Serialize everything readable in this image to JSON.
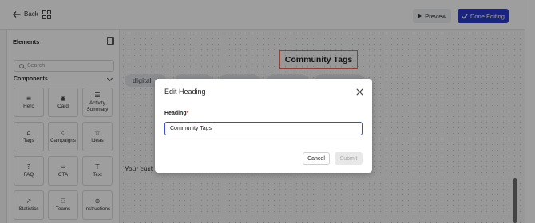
{
  "topbar": {
    "back_label": "Back",
    "preview_label": "Preview",
    "done_label": "Done Editing",
    "accent_color": "#2b3bc9"
  },
  "sidebar": {
    "title": "Elements",
    "search_placeholder": "Search",
    "section_label": "Components",
    "components": [
      {
        "label": "Hero",
        "icon": "≡"
      },
      {
        "label": "Card",
        "icon": "◉"
      },
      {
        "label": "Activity Summary",
        "icon": "☰"
      },
      {
        "label": "Tags",
        "icon": "⌂"
      },
      {
        "label": "Campaigns",
        "icon": "◁"
      },
      {
        "label": "Ideas",
        "icon": "☆"
      },
      {
        "label": "FAQ",
        "icon": "?"
      },
      {
        "label": "CTA",
        "icon": "⌗"
      },
      {
        "label": "Text",
        "icon": "T"
      },
      {
        "label": "Statistics",
        "icon": "↗"
      },
      {
        "label": "Teams",
        "icon": "⚇"
      },
      {
        "label": "Instructions",
        "icon": "⊕"
      }
    ]
  },
  "canvas": {
    "heading": "Community Tags",
    "pills": [
      "digital",
      "",
      "",
      "",
      ""
    ],
    "body_text": "Your cust"
  },
  "modal": {
    "title": "Edit Heading",
    "field_label": "Heading",
    "required_marker": "*",
    "field_value": "Community Tags",
    "cancel_label": "Cancel",
    "submit_label": "Submit"
  }
}
